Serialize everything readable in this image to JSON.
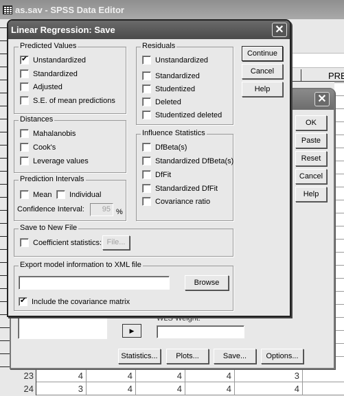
{
  "main_window": {
    "title": "as.sav - SPSS Data Editor",
    "visible_column_header": "PRE"
  },
  "data_rows": [
    {
      "row": "23",
      "cells": [
        "4",
        "4",
        "4",
        "4",
        "3"
      ]
    },
    {
      "row": "24",
      "cells": [
        "3",
        "4",
        "4",
        "4",
        "4"
      ]
    }
  ],
  "regression_dialog": {
    "close_label": "✕",
    "buttons": [
      "OK",
      "Paste",
      "Reset",
      "Cancel",
      "Help"
    ],
    "wls_weight_label": "WLS Weight:",
    "move_arrow": "▶",
    "bottom_buttons": [
      "Statistics...",
      "Plots...",
      "Save...",
      "Options..."
    ]
  },
  "save_dialog": {
    "title": "Linear Regression: Save",
    "close_label": "✕",
    "predicted_values": {
      "label": "Predicted Values",
      "items": [
        {
          "label": "Unstandardized",
          "checked": true
        },
        {
          "label": "Standardized",
          "checked": false
        },
        {
          "label": "Adjusted",
          "checked": false
        },
        {
          "label": "S.E. of mean predictions",
          "checked": false
        }
      ]
    },
    "distances": {
      "label": "Distances",
      "items": [
        {
          "label": "Mahalanobis",
          "checked": false
        },
        {
          "label": "Cook's",
          "checked": false
        },
        {
          "label": "Leverage values",
          "checked": false
        }
      ]
    },
    "prediction_intervals": {
      "label": "Prediction Intervals",
      "mean": {
        "label": "Mean",
        "checked": false
      },
      "individual": {
        "label": "Individual",
        "checked": false
      },
      "confidence_label": "Confidence Interval:",
      "confidence_value": "95",
      "percent": "%"
    },
    "residuals": {
      "label": "Residuals",
      "items": [
        {
          "label": "Unstandardized",
          "checked": false
        },
        {
          "label": "Standardized",
          "checked": false
        },
        {
          "label": "Studentized",
          "checked": false
        },
        {
          "label": "Deleted",
          "checked": false
        },
        {
          "label": "Studentized deleted",
          "checked": false
        }
      ]
    },
    "influence": {
      "label": "Influence Statistics",
      "items": [
        {
          "label": "DfBeta(s)",
          "checked": false
        },
        {
          "label": "Standardized DfBeta(s)",
          "checked": false
        },
        {
          "label": "DfFit",
          "checked": false
        },
        {
          "label": "Standardized DfFit",
          "checked": false
        },
        {
          "label": "Covariance ratio",
          "checked": false
        }
      ]
    },
    "save_new_file": {
      "label": "Save to New File",
      "coef_label": "Coefficient statistics:",
      "coef_checked": false,
      "file_button": "File..."
    },
    "export_xml": {
      "label": "Export model information to XML file",
      "path_value": "",
      "browse_button": "Browse",
      "include_cov_label": "Include the covariance matrix",
      "include_cov_checked": true
    },
    "buttons": {
      "continue": "Continue",
      "cancel": "Cancel",
      "help": "Help"
    }
  }
}
